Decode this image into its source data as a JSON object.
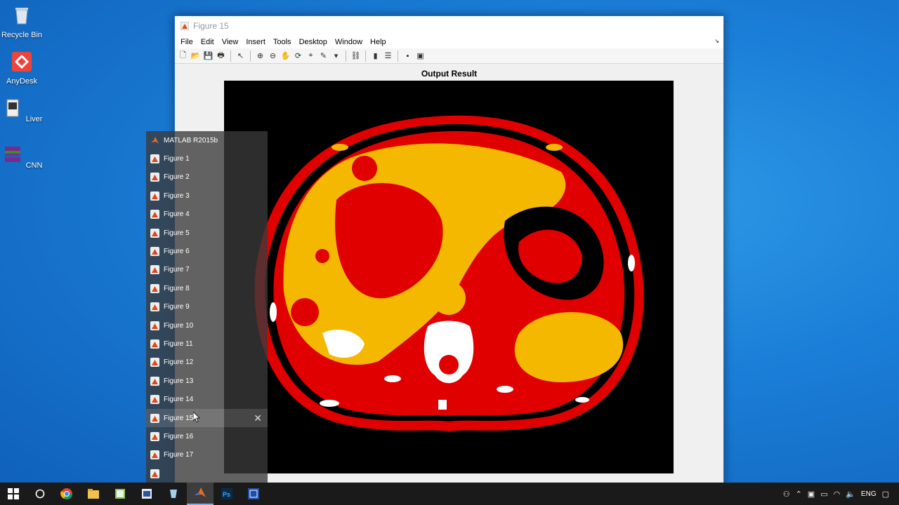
{
  "desktop": {
    "icons": [
      {
        "label": "Recycle Bin"
      },
      {
        "label": "AnyDesk"
      },
      {
        "label": "Liver"
      },
      {
        "label": "CNN"
      }
    ]
  },
  "figure": {
    "window_title": "Figure 15",
    "menu": [
      "File",
      "Edit",
      "View",
      "Insert",
      "Tools",
      "Desktop",
      "Window",
      "Help"
    ],
    "plot_title": "Output Result"
  },
  "jumplist": {
    "header": "MATLAB R2015b",
    "items": [
      "Figure 1",
      "Figure 2",
      "Figure 3",
      "Figure 4",
      "Figure 5",
      "Figure 6",
      "Figure 7",
      "Figure 8",
      "Figure 9",
      "Figure 10",
      "Figure 11",
      "Figure 12",
      "Figure 13",
      "Figure 14",
      "Figure 15",
      "Figure 16",
      "Figure 17",
      ""
    ],
    "active_item": "Figure 15"
  },
  "taskbar": {
    "apps": [
      "windows-start-icon",
      "cortana-icon",
      "chrome-icon",
      "file-explorer-icon",
      "notepad-icon",
      "word-icon",
      "app-icon",
      "matlab-icon",
      "photoshop-icon",
      "app-window-icon"
    ],
    "active_app": "matlab-icon",
    "tray_lang": "ENG"
  },
  "colors": {
    "desktop": "#1b7fd8",
    "seg_red": "#e00000",
    "seg_yellow": "#f5b800",
    "seg_white": "#ffffff"
  }
}
